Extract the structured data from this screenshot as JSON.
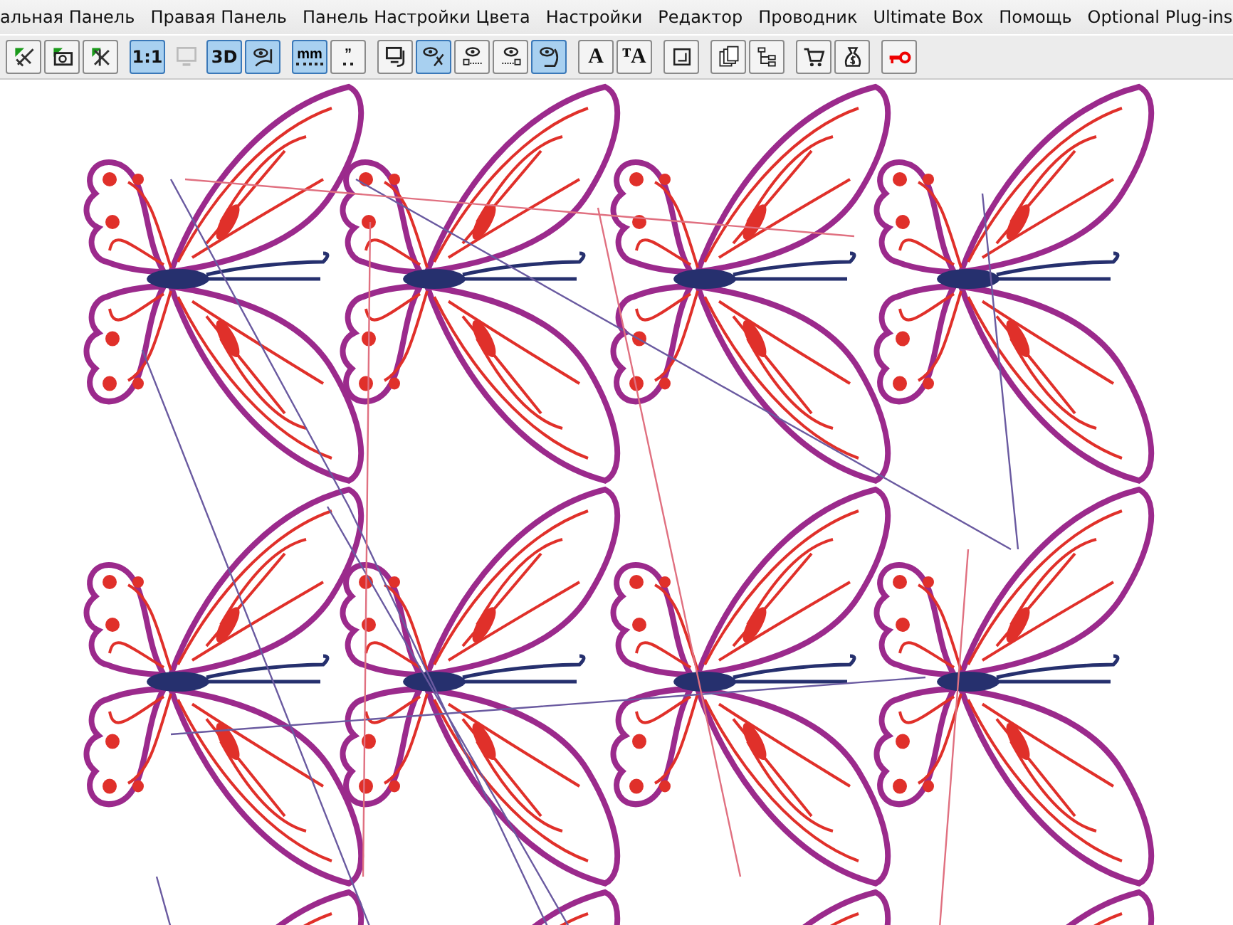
{
  "menu_bar": {
    "items": [
      "альная Панель",
      "Правая Панель",
      "Панель Настройки Цвета",
      "Настройки",
      "Редактор",
      "Проводник",
      "Ultimate Box",
      "Помощь",
      "Optional Plug-ins"
    ]
  },
  "toolbar": {
    "groups": [
      [
        {
          "kind": "needle",
          "pressed": false
        },
        {
          "kind": "camera",
          "pressed": false
        },
        {
          "kind": "cross",
          "pressed": false
        }
      ],
      [
        {
          "kind": "text",
          "label": "1:1",
          "pressed": true
        },
        {
          "kind": "monitor",
          "pressed": false,
          "disabled": true
        },
        {
          "kind": "text",
          "label": "3D",
          "pressed": true
        },
        {
          "kind": "eye",
          "pressed": true
        }
      ],
      [
        {
          "kind": "ruler",
          "label": "mm",
          "pressed": true
        },
        {
          "kind": "ruler",
          "label": "”",
          "pressed": false
        }
      ],
      [
        {
          "kind": "monitor-arrow",
          "pressed": false
        },
        {
          "kind": "eye-scissors",
          "pressed": true
        },
        {
          "kind": "eye-dots",
          "pressed": false
        },
        {
          "kind": "eye-line",
          "pressed": false
        },
        {
          "kind": "eye-bracket",
          "pressed": true
        }
      ],
      [
        {
          "kind": "text",
          "label": "A",
          "pressed": false
        },
        {
          "kind": "text",
          "label": "ᵀA",
          "pressed": false
        }
      ],
      [
        {
          "kind": "frame",
          "pressed": false
        }
      ],
      [
        {
          "kind": "pages",
          "pressed": false
        },
        {
          "kind": "tree",
          "pressed": false
        }
      ],
      [
        {
          "kind": "cart",
          "pressed": false
        },
        {
          "kind": "bag",
          "pressed": false
        }
      ],
      [
        {
          "kind": "key",
          "pressed": false
        }
      ]
    ]
  }
}
